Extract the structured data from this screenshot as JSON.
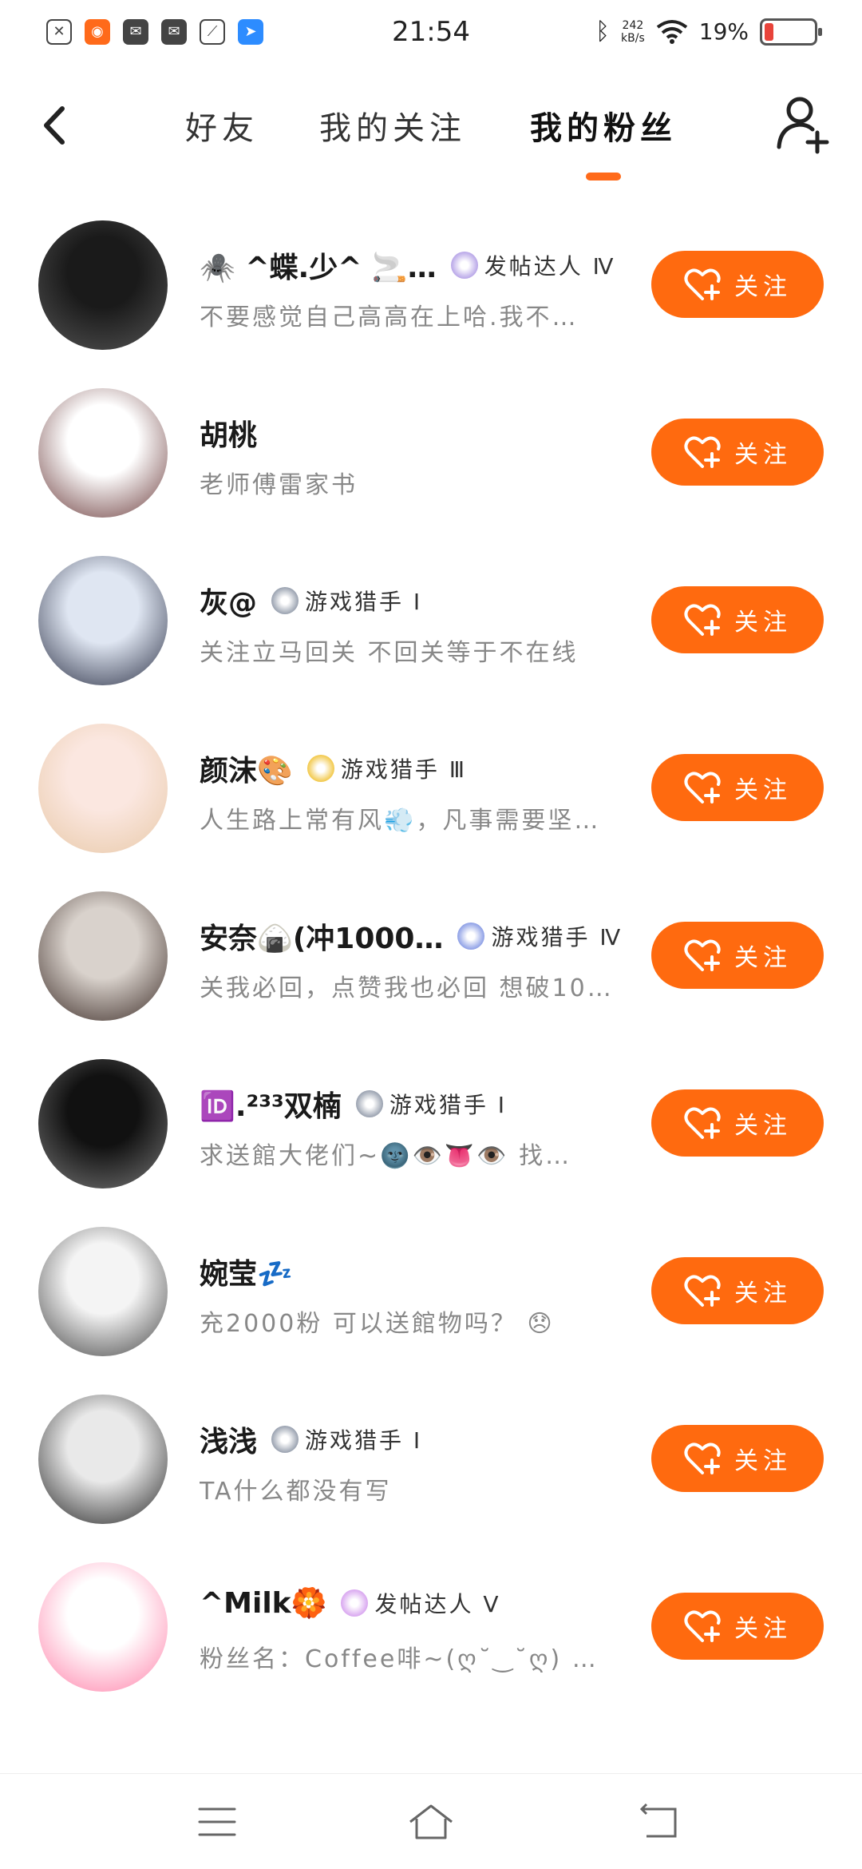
{
  "status_bar": {
    "time": "21:54",
    "net_speed_value": "242",
    "net_speed_unit": "kB/s",
    "battery_percent": "19%",
    "battery_level": 0.19,
    "battery_color": "#e8433a"
  },
  "header": {
    "tabs": [
      {
        "label": "好友",
        "active": false
      },
      {
        "label": "我的关注",
        "active": false
      },
      {
        "label": "我的粉丝",
        "active": true
      }
    ],
    "accent_color": "#ff6a0f"
  },
  "follow_label": "关注",
  "followers": [
    {
      "name": "🕷️ ^蝶.少^ 🚬…",
      "badge": "发帖达人 Ⅳ",
      "bio": "不要感觉自己高高在上哈.我不…"
    },
    {
      "name": "胡桃",
      "badge": "",
      "bio": "老师傅雷家书"
    },
    {
      "name": "灰@",
      "badge": "游戏猎手 Ⅰ",
      "bio": "关注立马回关 不回关等于不在线"
    },
    {
      "name": "颜沫🎨",
      "badge": "游戏猎手 Ⅲ",
      "bio": "人生路上常有风💨，凡事需要坚…"
    },
    {
      "name": "安奈🍙(冲1000…",
      "badge": "游戏猎手 Ⅳ",
      "bio": "关我必回，点赞我也必回 想破10…"
    },
    {
      "name": "🆔.²³³双楠",
      "badge": "游戏猎手 Ⅰ",
      "bio": "求送館大佬们~🌚👁️👅👁️ 找…"
    },
    {
      "name": "婉莹💤",
      "badge": "",
      "bio": "充2000粉 可以送館物吗？ 😞"
    },
    {
      "name": "浅浅",
      "badge": "游戏猎手 Ⅰ",
      "bio": "TA什么都没有写"
    },
    {
      "name": "^Milk🏵️",
      "badge": "发帖达人 Ⅴ",
      "bio": "粉丝名：Coffee啡~(ღ˘‿˘ღ) 有…"
    }
  ]
}
